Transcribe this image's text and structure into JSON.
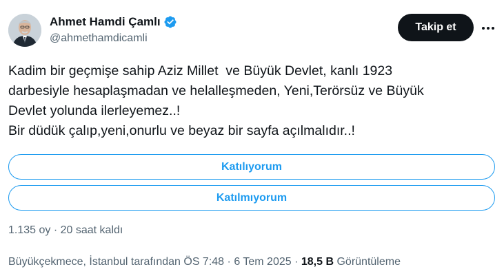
{
  "author": {
    "name": "Ahmet Hamdi Çamlı",
    "handle": "@ahmethamdicamli",
    "verified_color": "#1d9bf0"
  },
  "follow_label": "Takip et",
  "more_icon": "more-horizontal-icon",
  "tweet_lines": [
    "Kadim bir geçmişe sahip Aziz Millet  ve Büyük Devlet, kanlı 1923",
    "darbesiyle hesaplaşmadan ve helalleşmeden, Yeni,Terörsüz ve Büyük",
    "Devlet yolunda ilerleyemez..!",
    "Bir düdük çalıp,yeni,onurlu ve beyaz bir sayfa açılmalıdır..!"
  ],
  "poll": {
    "options": [
      "Katılıyorum",
      "Katılmıyorum"
    ],
    "votes": "1.135 oy",
    "separator": "·",
    "time_left": "20 saat kaldı"
  },
  "footer": {
    "location_time": "Büyükçekmece, İstanbul tarafından ÖS 7:48",
    "separator": "·",
    "date": "6 Tem 2025",
    "views_count": "18,5 B",
    "views_label": "Görüntüleme"
  },
  "colors": {
    "accent": "#1d9bf0",
    "text": "#0f1419",
    "muted": "#536471"
  }
}
